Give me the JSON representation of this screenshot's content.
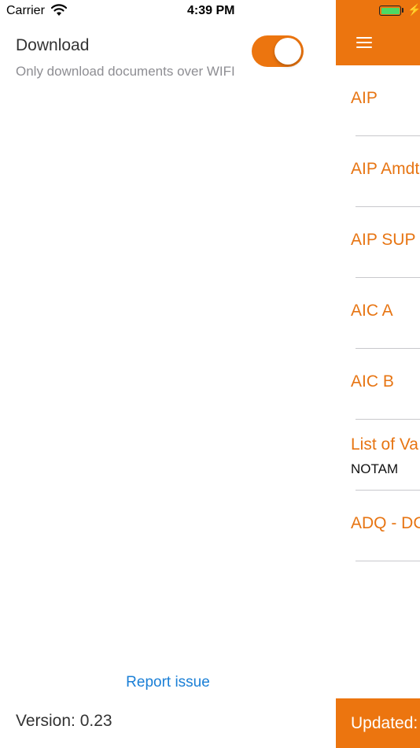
{
  "status_bar": {
    "carrier": "Carrier",
    "time": "4:39 PM"
  },
  "settings": {
    "download_title": "Download",
    "download_subtitle": "Only download documents over WIFI",
    "wifi_only_enabled": true,
    "report_issue": "Report issue",
    "version": "Version: 0.23"
  },
  "menu": {
    "items": [
      {
        "label": "AIP"
      },
      {
        "label": "AIP Amdt"
      },
      {
        "label": "AIP SUP"
      },
      {
        "label": "AIC A"
      },
      {
        "label": "AIC B"
      },
      {
        "label": "List of Va",
        "sublabel": "NOTAM"
      },
      {
        "label": "ADQ - DC"
      }
    ],
    "footer": "Updated:"
  },
  "colors": {
    "accent": "#ec750f",
    "link": "#1a7fd6",
    "battery": "#4cd964"
  },
  "icons": [
    "wifi-icon",
    "battery-icon",
    "charging-bolt-icon",
    "hamburger-menu-icon"
  ]
}
